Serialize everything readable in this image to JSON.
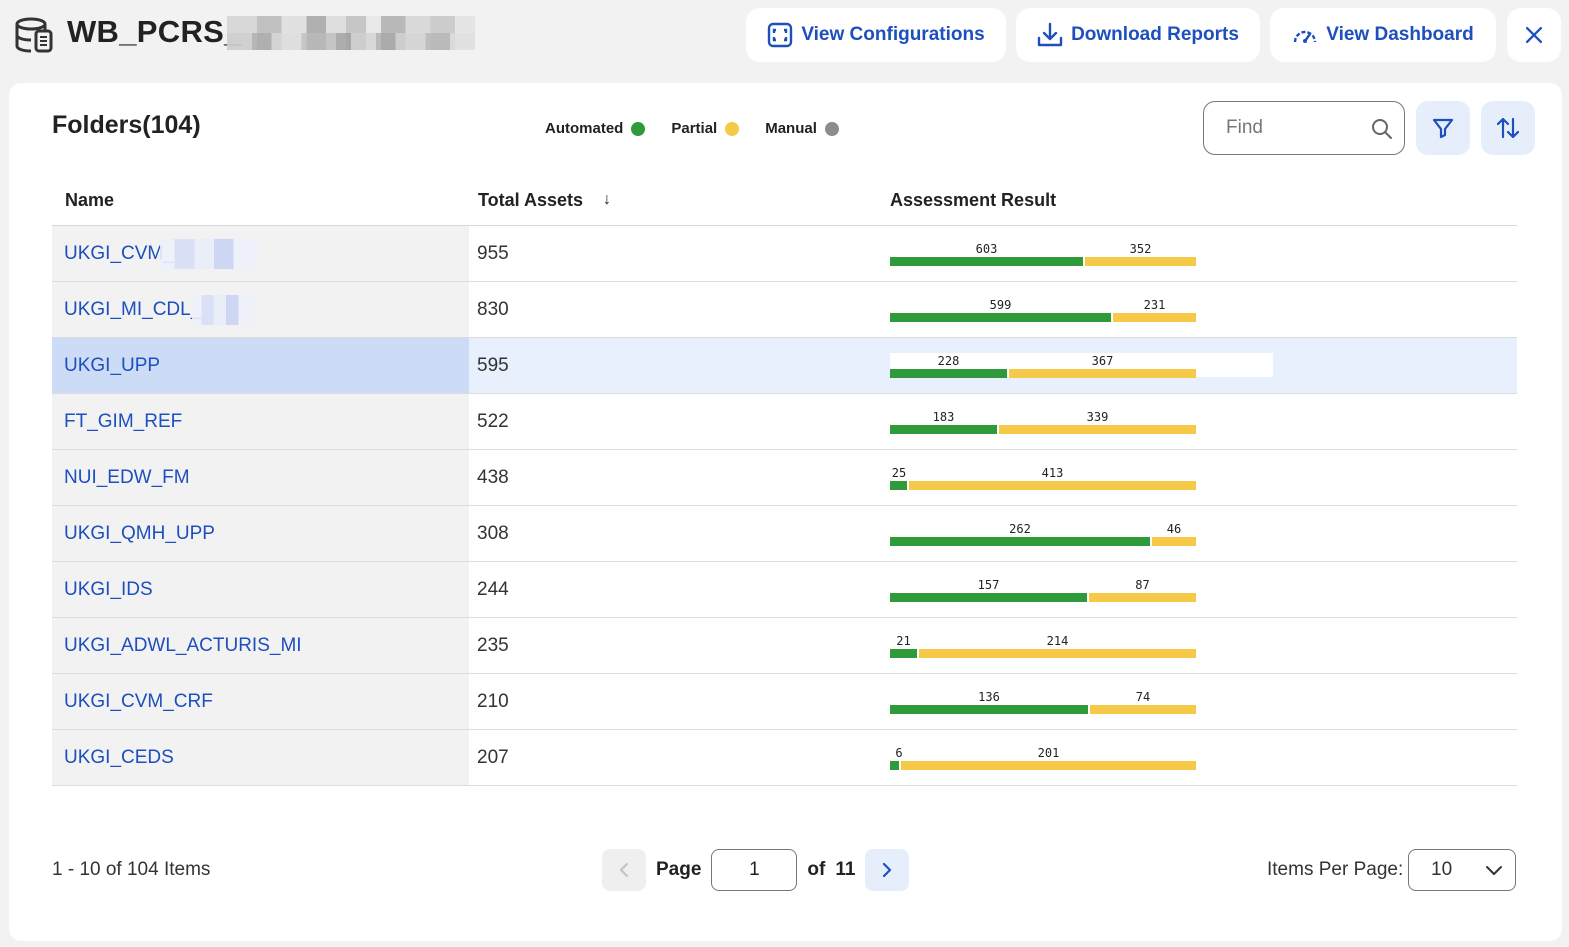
{
  "header": {
    "title": "WB_PCRS_",
    "buttons": {
      "view_configurations": "View Configurations",
      "download_reports": "Download Reports",
      "view_dashboard": "View Dashboard"
    }
  },
  "panel": {
    "title": "Folders(104)",
    "legend": [
      {
        "label": "Automated",
        "color": "#2e9a3a"
      },
      {
        "label": "Partial",
        "color": "#f7c948"
      },
      {
        "label": "Manual",
        "color": "#8c8c8c"
      }
    ],
    "find_placeholder": "Find"
  },
  "table": {
    "columns": {
      "name": "Name",
      "total": "Total Assets",
      "sort_indicator": "↓",
      "result": "Assessment Result"
    },
    "rows": [
      {
        "name": "UKGI_CVM_",
        "total": "955",
        "automated": 603,
        "partial": 352,
        "redacted": true
      },
      {
        "name": "UKGI_MI_CDL_",
        "total": "830",
        "automated": 599,
        "partial": 231,
        "redacted": true
      },
      {
        "name": "UKGI_UPP",
        "total": "595",
        "automated": 228,
        "partial": 367,
        "selected": true
      },
      {
        "name": "FT_GIM_REF",
        "total": "522",
        "automated": 183,
        "partial": 339
      },
      {
        "name": "NUI_EDW_FM",
        "total": "438",
        "automated": 25,
        "partial": 413
      },
      {
        "name": "UKGI_QMH_UPP",
        "total": "308",
        "automated": 262,
        "partial": 46
      },
      {
        "name": "UKGI_IDS",
        "total": "244",
        "automated": 157,
        "partial": 87
      },
      {
        "name": "UKGI_ADWL_ACTURIS_MI",
        "total": "235",
        "automated": 21,
        "partial": 214
      },
      {
        "name": "UKGI_CVM_CRF",
        "total": "210",
        "automated": 136,
        "partial": 74
      },
      {
        "name": "UKGI_CEDS",
        "total": "207",
        "automated": 6,
        "partial": 201
      }
    ]
  },
  "footer": {
    "items_count": "1 - 10 of 104 Items",
    "page_label": "Page",
    "page_value": "1",
    "of_label": "of",
    "total_pages": "11",
    "items_per_page_label": "Items Per Page:",
    "items_per_page_value": "10"
  },
  "colors": {
    "accent": "#1d4fbd",
    "automated": "#2e9a3a",
    "partial": "#f7c948",
    "manual": "#8c8c8c"
  }
}
